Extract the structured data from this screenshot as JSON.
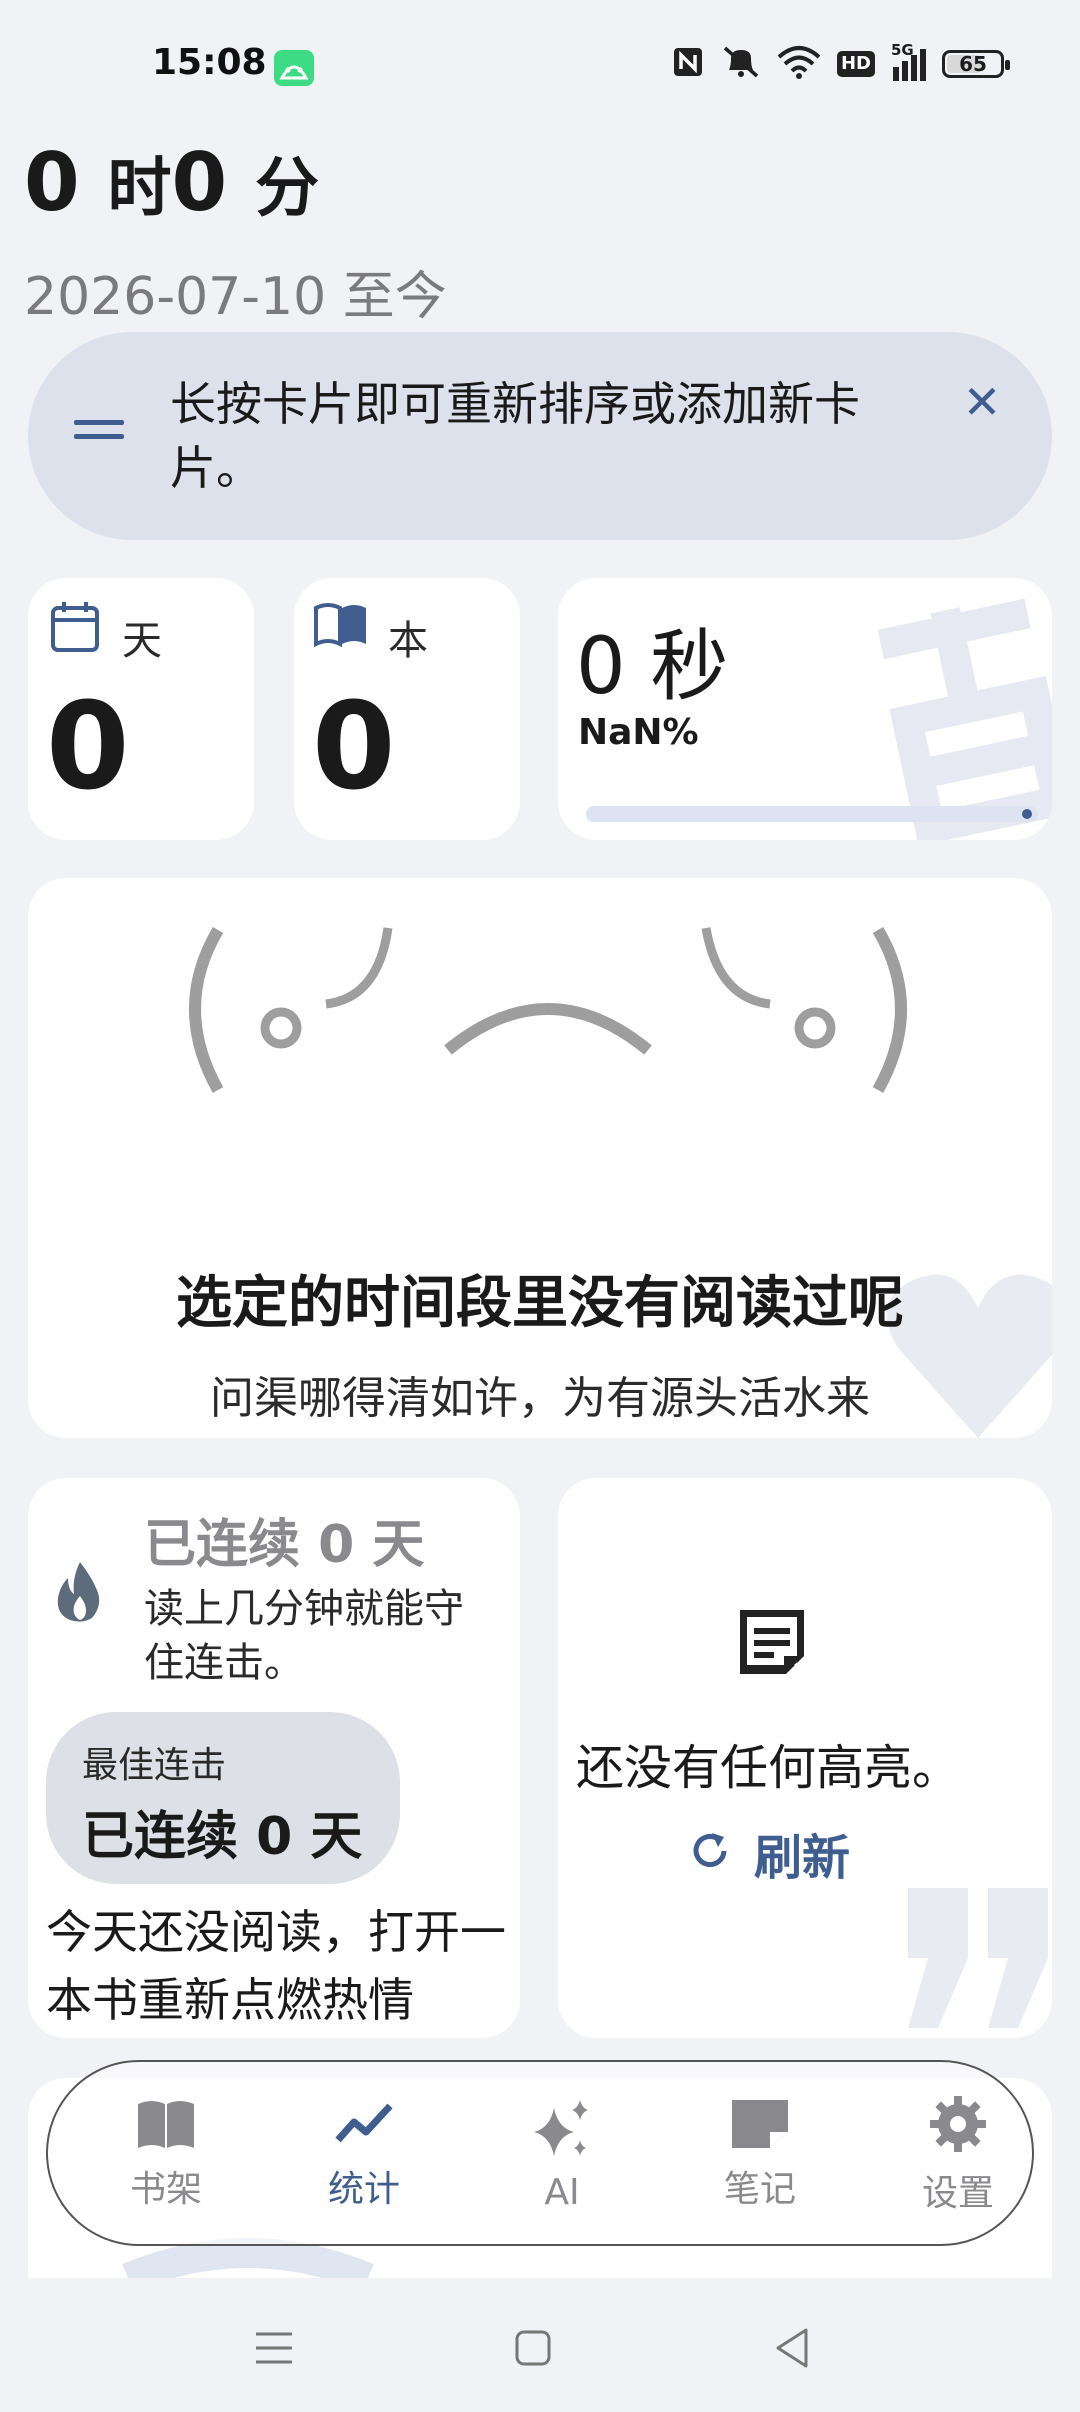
{
  "status_bar": {
    "time": "15:08",
    "network": "5G",
    "hd": "HD",
    "battery": "65",
    "battery_level": 0.65
  },
  "summary": {
    "hours": "0",
    "hours_unit": "时",
    "minutes": "0",
    "minutes_unit": "分",
    "date_range": "2026-07-10 至今"
  },
  "hint_card": {
    "text": "长按卡片即可重新排序或添加新卡片。"
  },
  "stats": {
    "days_label": "天",
    "days_value": "0",
    "books_label": "本",
    "books_value": "0",
    "time_value": "0 秒",
    "percent": "NaN%",
    "progress": 0
  },
  "empty_state": {
    "title": "选定的时间段里没有阅读过呢",
    "quote": "问渠哪得清如许，为有源头活水来"
  },
  "streak": {
    "title": "已连续 0 天",
    "subtitle": "读上几分钟就能守住连击。",
    "best_label": "最佳连击",
    "best_value": "已连续 0 天",
    "message": "今天还没阅读，打开一本书重新点燃热情"
  },
  "highlights": {
    "empty_text": "还没有任何高亮。",
    "refresh_label": "刷新"
  },
  "nav": {
    "items": [
      {
        "label": "书架",
        "icon": "book-open-icon"
      },
      {
        "label": "统计",
        "icon": "trend-icon",
        "active": true
      },
      {
        "label": "AI",
        "icon": "sparkle-icon"
      },
      {
        "label": "笔记",
        "icon": "note-icon"
      },
      {
        "label": "设置",
        "icon": "gear-icon"
      }
    ]
  },
  "colors": {
    "accent": "#3f5e8f",
    "background": "#f1f2f6",
    "hint_background": "#dde1ec",
    "card": "#ffffff"
  }
}
